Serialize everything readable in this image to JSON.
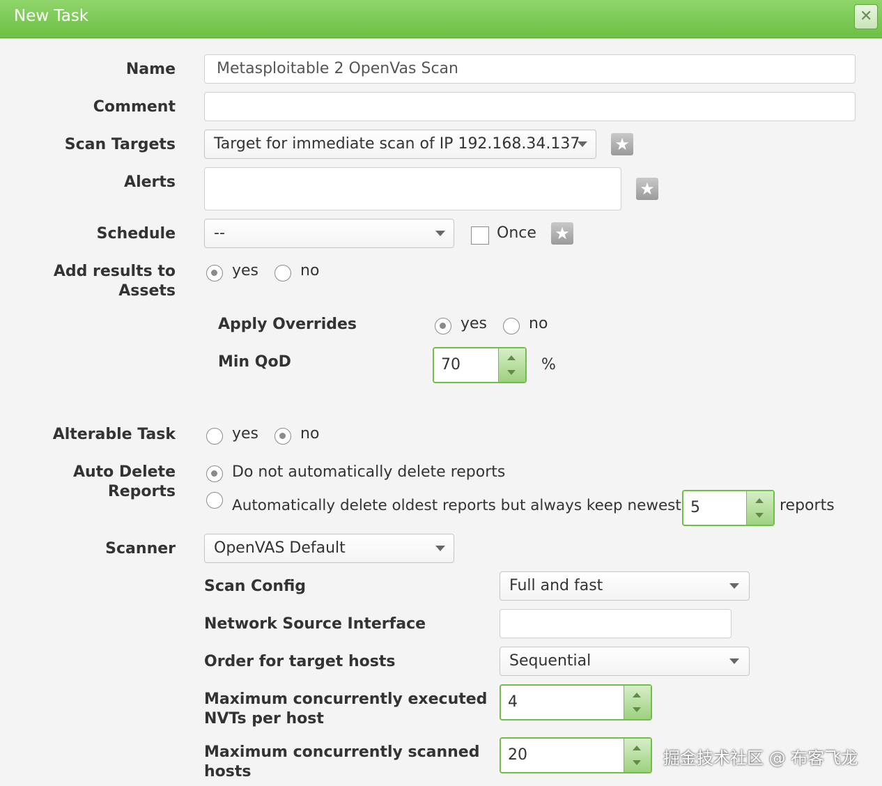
{
  "dialog": {
    "title": "New Task",
    "close_icon": "close-icon"
  },
  "labels": {
    "name": "Name",
    "comment": "Comment",
    "scan_targets": "Scan Targets",
    "alerts": "Alerts",
    "schedule": "Schedule",
    "add_results_line1": "Add results to",
    "add_results_line2": "Assets",
    "apply_overrides": "Apply Overrides",
    "min_qod": "Min QoD",
    "alterable_task": "Alterable Task",
    "auto_delete_line1": "Auto Delete",
    "auto_delete_line2": "Reports",
    "scanner": "Scanner",
    "scan_config": "Scan Config",
    "network_source_interface": "Network Source Interface",
    "order_target_hosts": "Order for target hosts",
    "max_nvts_line1": "Maximum concurrently executed",
    "max_nvts_line2": "NVTs per host",
    "max_hosts_line1": "Maximum concurrently scanned",
    "max_hosts_line2": "hosts"
  },
  "fields": {
    "name_value": "Metasploitable 2 OpenVas Scan",
    "comment_value": "",
    "scan_targets_selected": "Target for immediate scan of IP 192.168.34.137",
    "schedule_selected": "--",
    "schedule_once_label": "Once",
    "min_qod_value": "70",
    "min_qod_unit": "%",
    "keep_newest_value": "5",
    "keep_newest_unit": "reports",
    "scanner_selected": "OpenVAS Default",
    "scan_config_selected": "Full and fast",
    "network_source_interface_value": "",
    "order_target_hosts_selected": "Sequential",
    "max_nvts_value": "4",
    "max_hosts_value": "20"
  },
  "options": {
    "yes": "yes",
    "no": "no",
    "auto_delete_no": "Do not automatically delete reports",
    "auto_delete_keep": "Automatically delete oldest reports but always keep newest"
  },
  "state": {
    "add_results": "yes",
    "apply_overrides": "yes",
    "alterable_task": "no",
    "auto_delete": "no",
    "schedule_once": false
  },
  "watermark": "掘金技术社区 @ 布客飞龙",
  "colors": {
    "titlebar": "#7ac850",
    "accent": "#6dbf45"
  }
}
